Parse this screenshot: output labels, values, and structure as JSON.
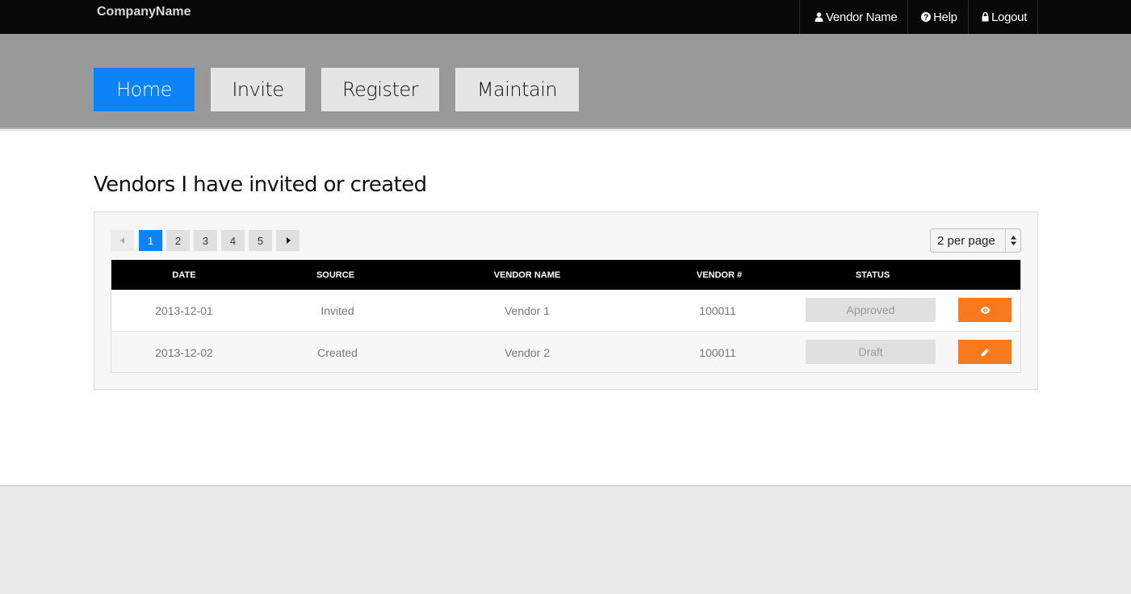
{
  "brand": "CompanyName",
  "topnav": {
    "vendor_name": "Vendor Name",
    "help": "Help",
    "logout": "Logout"
  },
  "mainnav": {
    "items": [
      "Home",
      "Invite",
      "Register",
      "Maintain"
    ],
    "active": "Home"
  },
  "page_title": "Vendors I have invited or created",
  "pagination": {
    "pages": [
      "1",
      "2",
      "3",
      "4",
      "5"
    ],
    "current": "1"
  },
  "per_page": "2 per page",
  "table": {
    "headers": [
      "DATE",
      "SOURCE",
      "VENDOR NAME",
      "VENDOR #",
      "STATUS"
    ],
    "rows": [
      {
        "date": "2013-12-01",
        "source": "Invited",
        "vendor_name": "Vendor 1",
        "vendor_no": "100011",
        "status": "Approved",
        "action_icon": "eye-icon"
      },
      {
        "date": "2013-12-02",
        "source": "Created",
        "vendor_name": "Vendor 2",
        "vendor_no": "100011",
        "status": "Draft",
        "action_icon": "pencil-icon"
      }
    ]
  },
  "colors": {
    "accent": "#0d83f8",
    "action": "#f97a1c",
    "topbar": "#080808",
    "band": "#999999"
  }
}
